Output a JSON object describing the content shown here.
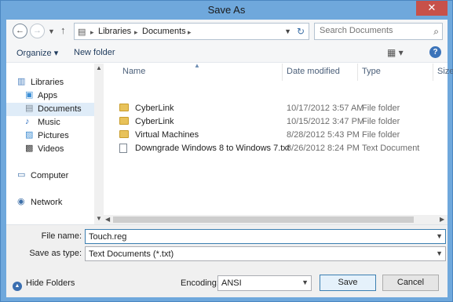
{
  "window": {
    "title": "Save As",
    "close": "✕"
  },
  "address": {
    "breadcrumbs": [
      "Libraries",
      "Documents"
    ],
    "separator": "▸"
  },
  "search": {
    "placeholder": "Search Documents"
  },
  "toolbar": {
    "organize_label": "Organize ▾",
    "new_folder_label": "New folder",
    "help": "?"
  },
  "sidebar": {
    "items": [
      {
        "label": "Libraries",
        "icon": "libraries-icon"
      },
      {
        "label": "Apps",
        "icon": "apps-icon"
      },
      {
        "label": "Documents",
        "icon": "documents-icon",
        "selected": true
      },
      {
        "label": "Music",
        "icon": "music-icon"
      },
      {
        "label": "Pictures",
        "icon": "pictures-icon"
      },
      {
        "label": "Videos",
        "icon": "videos-icon"
      },
      {
        "label": "Computer",
        "icon": "computer-icon"
      },
      {
        "label": "Network",
        "icon": "network-icon"
      }
    ]
  },
  "file_list": {
    "columns": [
      "Name",
      "Date modified",
      "Type",
      "Size"
    ],
    "rows": [
      {
        "name": "CyberLink",
        "date": "10/17/2012 3:57 AM",
        "type": "File folder",
        "icon": "folder-icon"
      },
      {
        "name": "CyberLink",
        "date": "10/15/2012 3:47 PM",
        "type": "File folder",
        "icon": "folder-icon"
      },
      {
        "name": "Virtual Machines",
        "date": "8/28/2012 5:43 PM",
        "type": "File folder",
        "icon": "folder-icon"
      },
      {
        "name": "Downgrade Windows 8 to Windows 7.txt",
        "date": "8/26/2012 8:24 PM",
        "type": "Text Document",
        "icon": "text-file-icon"
      }
    ]
  },
  "form": {
    "file_name_label": "File name:",
    "file_name_value": "Touch.reg",
    "save_type_label": "Save as type:",
    "save_type_value": "Text Documents (*.txt)",
    "encoding_label": "Encoding:",
    "encoding_value": "ANSI",
    "save_label": "Save",
    "cancel_label": "Cancel",
    "hide_folders_label": "Hide Folders"
  },
  "colors": {
    "title_bar": "#6fa8dc",
    "close_button": "#c7514a",
    "selection": "#dfecf8",
    "accent": "#3c7fb1"
  }
}
